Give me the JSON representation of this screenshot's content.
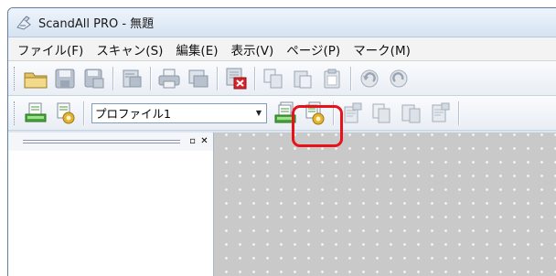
{
  "window": {
    "title": "ScandAll PRO - 無題"
  },
  "menubar": {
    "items": [
      "ファイル(F)",
      "スキャン(S)",
      "編集(E)",
      "表示(V)",
      "ページ(P)",
      "マーク(M)"
    ]
  },
  "toolbar1": {
    "icons": [
      "open-folder-icon",
      "save-icon",
      "save-as-icon",
      "properties-icon",
      "print-icon",
      "print-preview-icon",
      "delete-icon",
      "copy-icon",
      "paste-special-icon",
      "paste-icon",
      "undo-icon",
      "redo-icon"
    ]
  },
  "toolbar2": {
    "profile_select": {
      "value": "プロファイル1"
    },
    "icons": [
      "scan-icon",
      "scan-settings-icon",
      "scan-profile-icon",
      "profile-settings-icon",
      "page-insert-icon",
      "page-copy-icon",
      "page-move-icon",
      "page-replace-icon"
    ]
  },
  "highlight": {
    "target": "scan-profile-button",
    "color": "#e8121b"
  }
}
